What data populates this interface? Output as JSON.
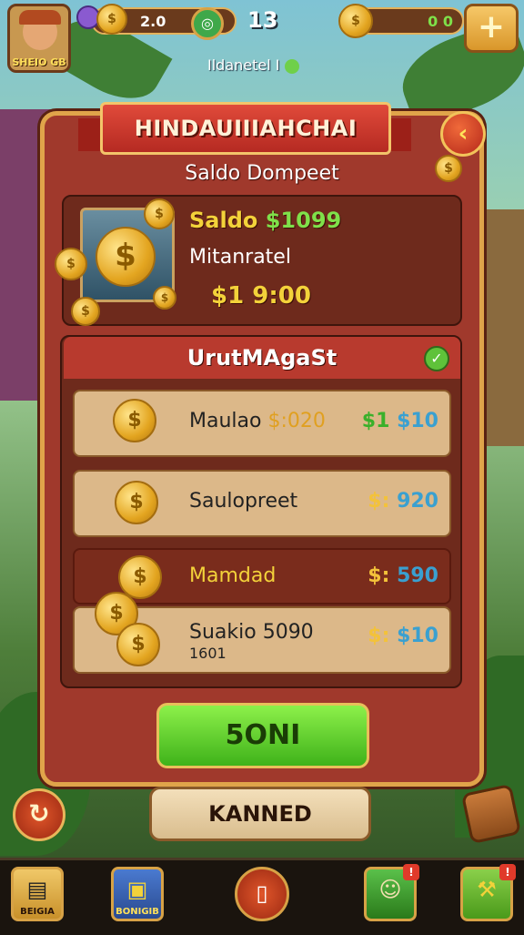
{
  "top_bar": {
    "player_name": "SHEIO GB",
    "coins_left": "2.0",
    "level": "13",
    "coins_right": "0 0",
    "plus_symbol": "+"
  },
  "subtitle": "Ildanetel I",
  "panel": {
    "banner_title": "HINDAUIIIAHCHAI",
    "close_symbol": "‹",
    "subtitle": "Saldo Dompeet",
    "wallet": {
      "saldo_label": "Saldo",
      "saldo_value": "$1099",
      "label": "Mitanratel",
      "value": "$1 9:00"
    },
    "list_title": "UrutMAgaSt",
    "rows": [
      {
        "name": "Maulao",
        "name_value": "$:020",
        "amount_prefix": "$1",
        "amount_value": "$10",
        "dark": false
      },
      {
        "name": "Saulopreet",
        "amount_prefix": "$:",
        "amount_value": "920",
        "dark": false
      },
      {
        "name": "Mamdad",
        "amount_prefix": "$:",
        "amount_value": "590",
        "dark": true
      },
      {
        "name": "Suakio 5090",
        "extra": "1601",
        "amount_prefix": "$:",
        "amount_value": "$10",
        "dark": false
      }
    ],
    "primary_button": "5ONI",
    "secondary_button": "KANNED"
  },
  "bottom_nav": [
    {
      "label": "BEIGIA",
      "icon": "scroll-icon"
    },
    {
      "label": "BONIGIB",
      "icon": "treasure-map-icon"
    },
    {
      "label": "",
      "icon": "card-icon"
    },
    {
      "label": "",
      "icon": "npc-icon",
      "badge": "!"
    },
    {
      "label": "",
      "icon": "hammer-icon",
      "badge": "!"
    }
  ],
  "colors": {
    "panel": "#a0392c",
    "banner": "#e04a3a",
    "green_button": "#5fd02a",
    "gold": "#f3d23a"
  }
}
